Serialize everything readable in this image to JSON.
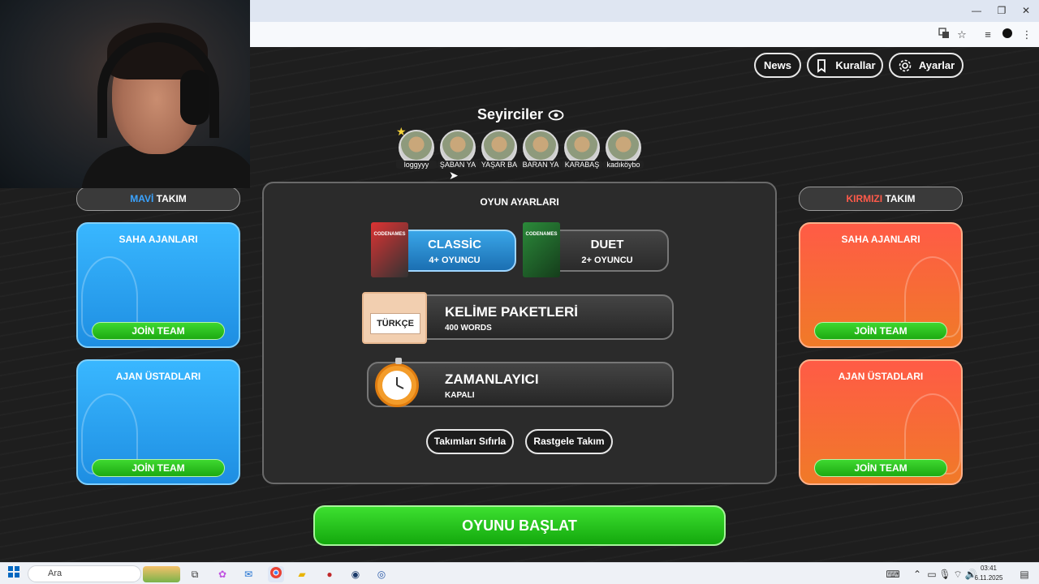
{
  "browser": {
    "controls": {
      "minimize": "—",
      "restore": "❐",
      "close": "✕"
    },
    "address_icons": [
      "translate-icon",
      "star-icon",
      "media-icon",
      "profile-icon",
      "menu-icon"
    ]
  },
  "header": {
    "news_label": "News",
    "rules_label": "Kurallar",
    "settings_label": "Ayarlar"
  },
  "spectators": {
    "title": "Seyirciler",
    "list": [
      {
        "name": "loggyyy"
      },
      {
        "name": "ŞABAN YA"
      },
      {
        "name": "YAŞAR BA"
      },
      {
        "name": "BARAN YA"
      },
      {
        "name": "KARABAŞ"
      },
      {
        "name": "kadıköybo"
      }
    ]
  },
  "blue_team": {
    "color_word": "MAVİ",
    "team_word": "TAKIM",
    "field_agents": {
      "title": "SAHA AJANLARI",
      "join_label": "JOİN TEAM"
    },
    "spymasters": {
      "title": "AJAN ÜSTADLARI",
      "join_label": "JOİN TEAM"
    }
  },
  "red_team": {
    "color_word": "KIRMIZI",
    "team_word": "TAKIM",
    "field_agents": {
      "title": "SAHA AJANLARI",
      "join_label": "JOİN TEAM"
    },
    "spymasters": {
      "title": "AJAN ÜSTADLARI",
      "join_label": "JOİN TEAM"
    }
  },
  "settings": {
    "title": "OYUN AYARLARI",
    "modes": [
      {
        "name": "CLASSİC",
        "players": "4+ OYUNCU",
        "box_text": "CODENAMES"
      },
      {
        "name": "DUET",
        "players": "2+ OYUNCU",
        "box_text": "CODENAMES"
      }
    ],
    "word_packs": {
      "title": "KELİME PAKETLERİ",
      "subtitle": "400 WORDS",
      "card_label": "TÜRKÇE"
    },
    "timer": {
      "title": "ZAMANLAYICI",
      "subtitle": "KAPALI"
    },
    "reset_label": "Takımları Sıfırla",
    "random_label": "Rastgele Takım"
  },
  "start_label": "OYUNU BAŞLAT",
  "taskbar": {
    "search_placeholder": "Ara",
    "time": "03:41",
    "date": "6.11.2025"
  },
  "colors": {
    "blue_team": "#39b7ff",
    "red_team": "#ff5b46",
    "start_green": "#1fbf18"
  }
}
